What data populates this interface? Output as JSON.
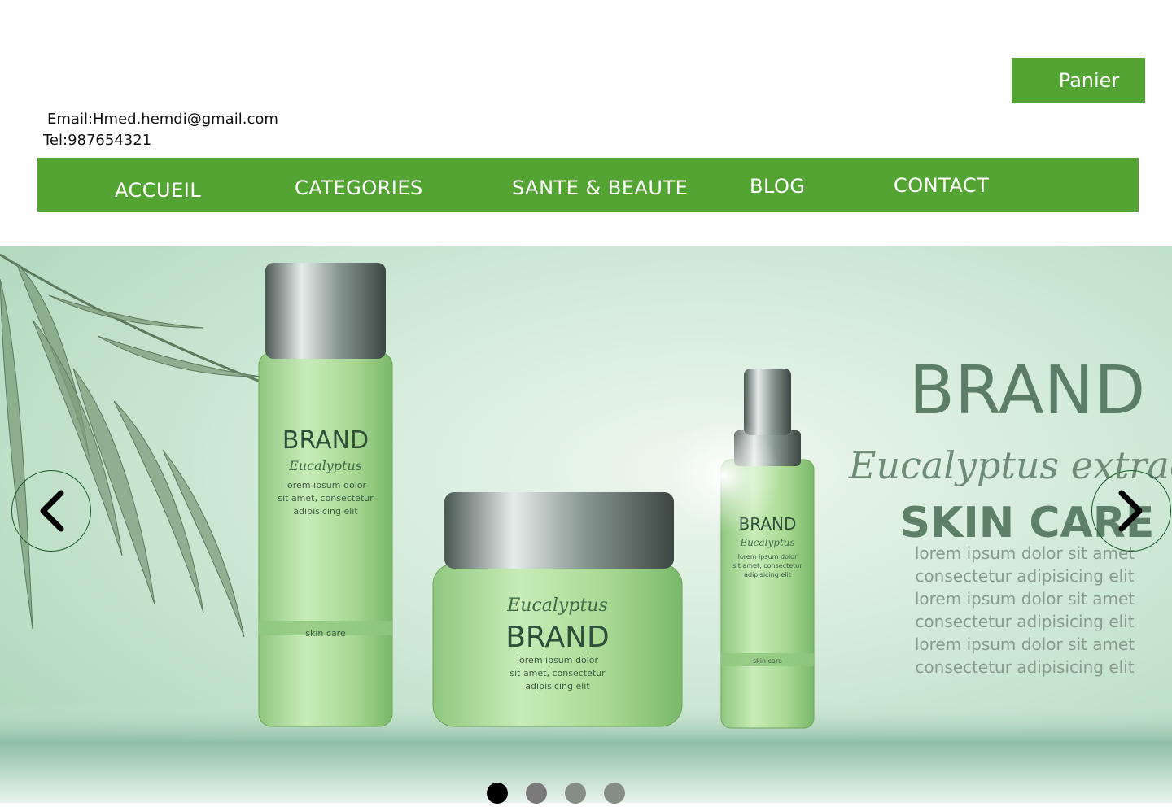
{
  "header": {
    "cart_label": "Panier",
    "email": "Email:Hmed.hemdi@gmail.com",
    "tel": "Tel:987654321"
  },
  "nav": {
    "items": [
      {
        "label": "ACCUEIL"
      },
      {
        "label": "CATEGORIES"
      },
      {
        "label": "SANTE & BEAUTE"
      },
      {
        "label": "BLOG"
      },
      {
        "label": "CONTACT"
      }
    ]
  },
  "hero": {
    "brand": "BRAND",
    "subtitle": "Eucalyptus extract",
    "headline": "SKIN CARE",
    "body_lines": [
      "lorem ipsum dolor sit amet",
      "consectetur adipisicing elit",
      "lorem ipsum dolor sit amet",
      "consectetur adipisicing elit",
      "lorem ipsum dolor sit amet",
      "consectetur adipisicing elit"
    ],
    "bottle_brand": "BRAND",
    "bottle_sub": "Eucalyptus",
    "bottle_text": [
      "lorem ipsum dolor",
      "sit amet, consectetur",
      "adipisicing elit"
    ],
    "bottle_label": "skin care",
    "jar_sub": "Eucalyptus",
    "jar_brand": "BRAND",
    "jar_text": [
      "lorem ipsum dolor",
      "sit amet, consectetur",
      "adipisicing elit"
    ],
    "spray_brand": "BRAND",
    "spray_sub": "Eucalyptus",
    "spray_text": [
      "lorem ipsum dolor",
      "sit amet, consectetur",
      "adipisicing elit"
    ],
    "spray_label": "skin care"
  },
  "carousel": {
    "slide_count": 4,
    "active_index": 0,
    "prev_icon": "chevron-left-icon",
    "next_icon": "chevron-right-icon"
  },
  "colors": {
    "accent": "#53a432",
    "text_on_accent": "#ffffff"
  }
}
